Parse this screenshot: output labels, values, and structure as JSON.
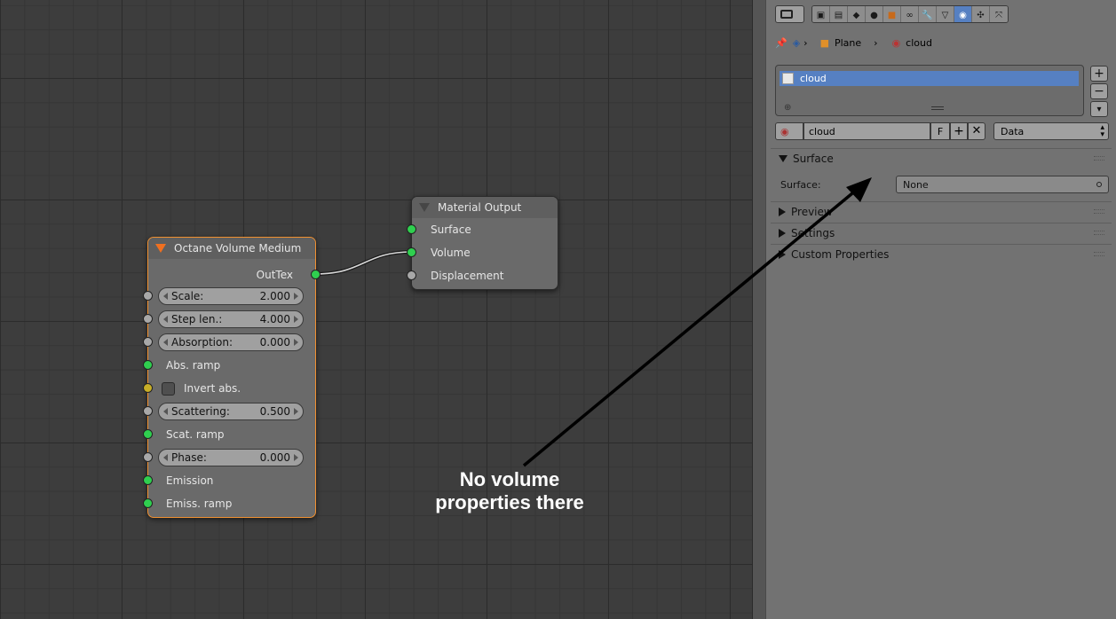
{
  "node_editor": {
    "volume_node": {
      "title": "Octane Volume Medium",
      "output_label": "OutTex",
      "fields": [
        {
          "label": "Scale:",
          "value": "2.000"
        },
        {
          "label": "Step len.:",
          "value": "4.000"
        },
        {
          "label": "Absorption:",
          "value": "0.000"
        },
        {
          "label": "Scattering:",
          "value": "0.500"
        },
        {
          "label": "Phase:",
          "value": "0.000"
        }
      ],
      "inputs": {
        "abs_ramp": "Abs. ramp",
        "invert_abs": "Invert abs.",
        "scat_ramp": "Scat. ramp",
        "emission": "Emission",
        "emiss_ramp": "Emiss. ramp"
      }
    },
    "output_node": {
      "title": "Material Output",
      "inputs": [
        "Surface",
        "Volume",
        "Displacement"
      ]
    }
  },
  "properties": {
    "breadcrumb": {
      "object": "Plane",
      "material": "cloud"
    },
    "material_slots": [
      {
        "name": "cloud",
        "selected": true
      }
    ],
    "material_field": "cloud",
    "fake_user": "F",
    "link_mode": "Data",
    "panels": {
      "surface": "Surface",
      "surface_label": "Surface:",
      "surface_value": "None",
      "preview": "Preview",
      "settings": "Settings",
      "custom": "Custom Properties"
    }
  },
  "annotation": {
    "line1": "No volume",
    "line2": "properties there"
  },
  "colors": {
    "selected_border": "#f09030",
    "socket_green": "#2fcf4f",
    "socket_grey": "#a8a8a8",
    "socket_yellow": "#c7ae27",
    "active_blue": "#5680c2"
  }
}
